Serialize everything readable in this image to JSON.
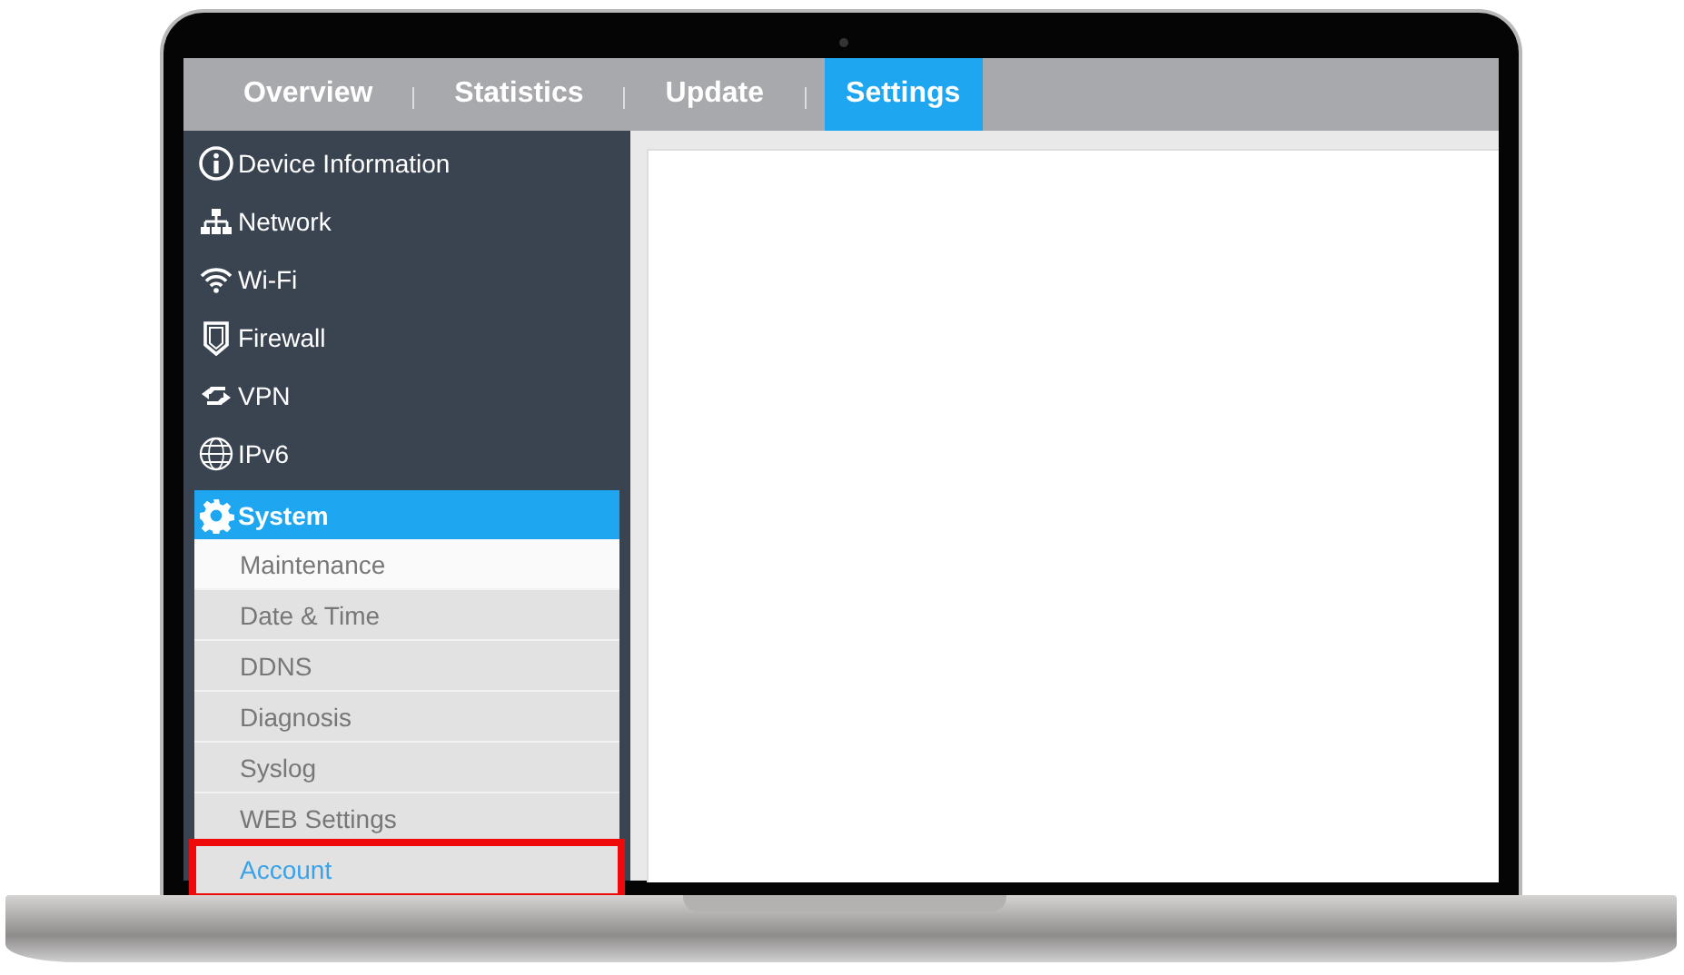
{
  "tabs": [
    {
      "label": "Overview",
      "selected": false
    },
    {
      "label": "Statistics",
      "selected": false
    },
    {
      "label": "Update",
      "selected": false
    },
    {
      "label": "Settings",
      "selected": true
    }
  ],
  "sidebar": {
    "items": [
      {
        "label": "Device Information",
        "expanded": false
      },
      {
        "label": "Network",
        "expanded": false
      },
      {
        "label": "Wi-Fi",
        "expanded": false
      },
      {
        "label": "Firewall",
        "expanded": false
      },
      {
        "label": "VPN",
        "expanded": false
      },
      {
        "label": "IPv6",
        "expanded": false
      },
      {
        "label": "System",
        "expanded": true,
        "children": [
          {
            "label": "Maintenance",
            "selected": false,
            "hovered": true,
            "annotated": false
          },
          {
            "label": "Date & Time",
            "selected": false,
            "hovered": false,
            "annotated": false
          },
          {
            "label": "DDNS",
            "selected": false,
            "hovered": false,
            "annotated": false
          },
          {
            "label": "Diagnosis",
            "selected": false,
            "hovered": false,
            "annotated": false
          },
          {
            "label": "Syslog",
            "selected": false,
            "hovered": false,
            "annotated": false
          },
          {
            "label": "WEB Settings",
            "selected": false,
            "hovered": false,
            "annotated": false
          },
          {
            "label": "Account",
            "selected": true,
            "hovered": false,
            "annotated": true
          }
        ]
      }
    ]
  }
}
